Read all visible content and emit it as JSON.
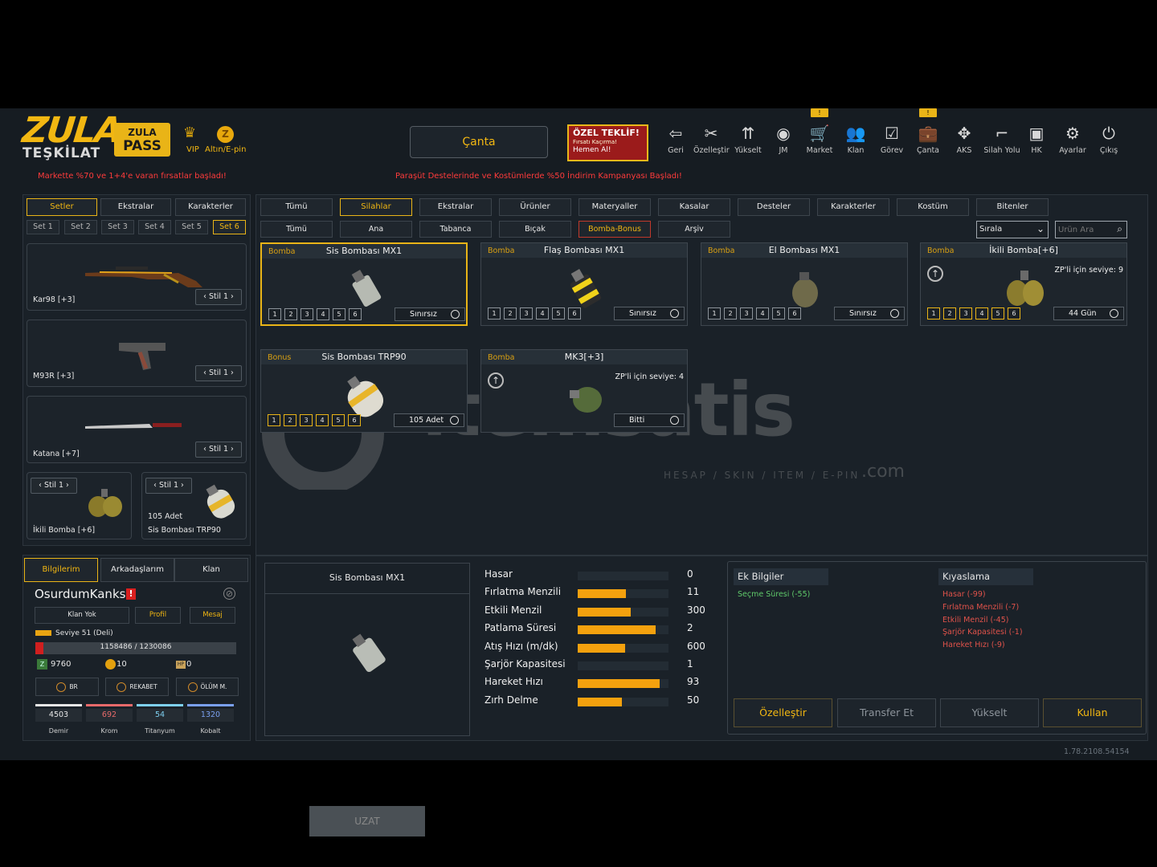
{
  "header": {
    "logo_top": "ZULA",
    "logo_bottom": "TEŞKİLAT",
    "pass_top": "ZULA",
    "pass_bottom": "PASS",
    "vip": "VIP",
    "altin": "Altın/E-pin",
    "coin_letter": "Z",
    "promo_left": "Markette %70 ve 1+4'e varan fırsatlar başladı!",
    "promo_center": "Paraşüt Destelerinde ve Kostümlerde %50 İndirim Kampanyası Başladı!",
    "canta_button": "Çanta",
    "offer": {
      "title": "ÖZEL TEKLİF!",
      "sub": "Fırsatı Kaçırma!",
      "cta": "Hemen Al!"
    }
  },
  "nav": [
    {
      "label": "Geri",
      "icon": "back-icon",
      "glyph": "⇦"
    },
    {
      "label": "Özelleştir",
      "icon": "tools-icon",
      "glyph": "✂"
    },
    {
      "label": "Yükselt",
      "icon": "rank-up-icon",
      "glyph": "⇈"
    },
    {
      "label": "JM",
      "icon": "coins-icon",
      "glyph": "◉"
    },
    {
      "label": "Market",
      "icon": "cart-icon",
      "glyph": "🛒",
      "badge": "!"
    },
    {
      "label": "Klan",
      "icon": "clan-icon",
      "glyph": "👥"
    },
    {
      "label": "Görev",
      "icon": "task-icon",
      "glyph": "☑"
    },
    {
      "label": "Çanta",
      "icon": "bag-icon",
      "glyph": "💼",
      "badge": "!",
      "active": true
    },
    {
      "label": "AKS",
      "icon": "aks-icon",
      "glyph": "✥"
    },
    {
      "label": "Silah Yolu",
      "icon": "gun-icon",
      "glyph": "⌐"
    },
    {
      "label": "HK",
      "icon": "hk-icon",
      "glyph": "▣"
    },
    {
      "label": "Ayarlar",
      "icon": "gear-icon",
      "glyph": "⚙"
    },
    {
      "label": "Çıkış",
      "icon": "power-icon",
      "glyph": "⏻"
    }
  ],
  "left": {
    "tabs": [
      "Setler",
      "Ekstralar",
      "Karakterler"
    ],
    "sets": [
      "Set 1",
      "Set 2",
      "Set 3",
      "Set 4",
      "Set 5",
      "Set 6"
    ],
    "weapons": [
      {
        "name": "Kar98 [+3]",
        "stil": "‹ Stil 1 ›"
      },
      {
        "name": "M93R [+3]",
        "stil": "‹ Stil 1 ›"
      },
      {
        "name": "Katana [+7]",
        "stil": "‹ Stil 1 ›"
      }
    ],
    "grenades": [
      {
        "name": "İkili Bomba [+6]",
        "stil": "‹ Stil 1 ›",
        "count": ""
      },
      {
        "name": "Sis Bombası TRP90",
        "stil": "‹ Stil 1 ›",
        "count": "105 Adet"
      }
    ]
  },
  "profile": {
    "tabs": [
      "Bilgilerim",
      "Arkadaşlarım",
      "Klan"
    ],
    "username": "OsurdumKanks",
    "alert": "!",
    "buttons": [
      "Klan Yok",
      "Profil",
      "Mesaj"
    ],
    "level": "Seviye 51 (Deli)",
    "xp": "1158486 / 1230086",
    "xp_fraction": 0.04,
    "zp": "9760",
    "gold": "10",
    "hp": "0",
    "badges": [
      "BR",
      "REKABET",
      "ÖLÜM M."
    ],
    "materials": [
      {
        "value": "4503",
        "name": "Demir",
        "color": "#e6e6e6"
      },
      {
        "value": "692",
        "name": "Krom",
        "color": "#e86a6a"
      },
      {
        "value": "54",
        "name": "Titanyum",
        "color": "#7ed0f0"
      },
      {
        "value": "1320",
        "name": "Kobalt",
        "color": "#7aa0f0"
      }
    ]
  },
  "main": {
    "cat_tabs": [
      "Tümü",
      "Silahlar",
      "Ekstralar",
      "Ürünler",
      "Materyaller",
      "Kasalar",
      "Desteler",
      "Karakterler",
      "Kostüm",
      "Bitenler"
    ],
    "sub_tabs": [
      "Tümü",
      "Ana",
      "Tabanca",
      "Bıçak",
      "Bomba-Bonus",
      "Arşiv"
    ],
    "sort": "Sırala",
    "search_placeholder": "Ürün Ara",
    "items": [
      {
        "cat": "Bomba",
        "name": "Sis Bombası MX1",
        "duration": "Sınırsız",
        "levels": [
          "1",
          "2",
          "3",
          "4",
          "5",
          "6"
        ],
        "zp": ""
      },
      {
        "cat": "Bomba",
        "name": "Flaş Bombası MX1",
        "duration": "Sınırsız",
        "levels": [
          "1",
          "2",
          "3",
          "4",
          "5",
          "6"
        ],
        "zp": ""
      },
      {
        "cat": "Bomba",
        "name": "El Bombası MX1",
        "duration": "Sınırsız",
        "levels": [
          "1",
          "2",
          "3",
          "4",
          "5",
          "6"
        ],
        "zp": ""
      },
      {
        "cat": "Bomba",
        "name": "İkili Bomba[+6]",
        "duration": "44 Gün",
        "levels": [
          "1",
          "2",
          "3",
          "4",
          "5",
          "6"
        ],
        "zp": "ZP'li için seviye: 9"
      },
      {
        "cat": "Bonus",
        "name": "Sis Bombası TRP90",
        "duration": "105 Adet",
        "levels": [
          "1",
          "2",
          "3",
          "4",
          "5",
          "6"
        ],
        "zp": ""
      },
      {
        "cat": "Bomba",
        "name": "MK3[+3]",
        "duration": "Bitti",
        "levels": [],
        "zp": "ZP'li için seviye: 4"
      }
    ]
  },
  "detail": {
    "title": "Sis Bombası MX1",
    "uzat": "UZAT",
    "stats": [
      {
        "label": "Hasar",
        "value": "0",
        "fill": 0
      },
      {
        "label": "Fırlatma Menzili",
        "value": "11",
        "fill": 0.53
      },
      {
        "label": "Etkili Menzil",
        "value": "300",
        "fill": 0.58
      },
      {
        "label": "Patlama Süresi",
        "value": "2",
        "fill": 0.86
      },
      {
        "label": "Atış Hızı (m/dk)",
        "value": "600",
        "fill": 0.52
      },
      {
        "label": "Şarjör Kapasitesi",
        "value": "1",
        "fill": 0
      },
      {
        "label": "Hareket Hızı",
        "value": "93",
        "fill": 0.9
      },
      {
        "label": "Zırh Delme",
        "value": "50",
        "fill": 0.49
      }
    ],
    "extra_title": "Ek Bilgiler",
    "extra_items": [
      "Seçme Süresi (-55)"
    ],
    "compare_title": "Kıyaslama",
    "compare_items": [
      "Hasar (-99)",
      "Fırlatma Menzili (-7)",
      "Etkili Menzil (-45)",
      "Şarjör Kapasitesi (-1)",
      "Hareket Hızı (-9)"
    ],
    "actions": [
      "Özelleştir",
      "Transfer Et",
      "Yükselt",
      "Kullan"
    ]
  },
  "version": "1.78.2108.54154",
  "watermark": {
    "brand": "itemsatis",
    "tag": "HESAP / SKIN / ITEM / E-PIN",
    "dotcom": ".com"
  }
}
